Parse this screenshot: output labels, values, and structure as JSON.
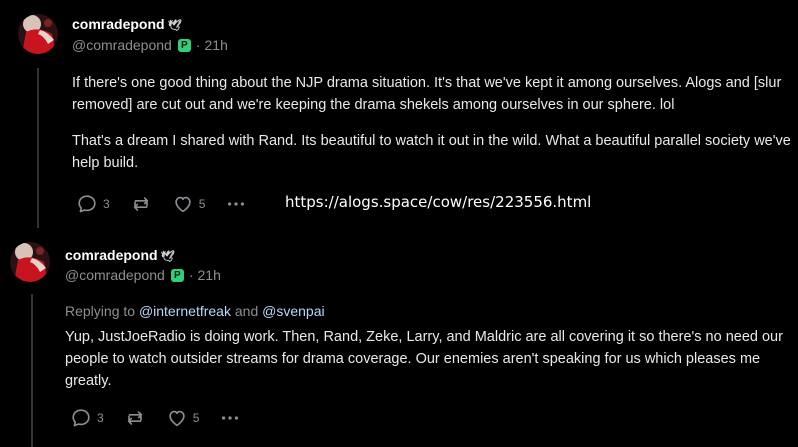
{
  "posts": [
    {
      "display_name": "comradepond",
      "name_emoji": "🕊",
      "handle": "@comradepond",
      "badge_letter": "P",
      "separator": "·",
      "timestamp": "21h",
      "body": [
        "If there's one good thing about the NJP drama situation. It's that we've kept it among ourselves. Alogs and [slur removed] are cut out and we're keeping the drama shekels among ourselves in our sphere. lol",
        "That's a dream I shared with Rand. Its beautiful to watch it out in the wild. What a beautiful parallel society we've help build."
      ],
      "actions": {
        "reply_count": "3",
        "like_count": "5"
      }
    },
    {
      "display_name": "comradepond",
      "name_emoji": "🕊",
      "handle": "@comradepond",
      "badge_letter": "P",
      "separator": "·",
      "timestamp": "21h",
      "replying_prefix": "Replying to ",
      "replying_mention_1": "@internetfreak",
      "replying_and": " and ",
      "replying_mention_2": "@svenpai",
      "body": [
        "Yup, JustJoeRadio is doing work. Then, Rand, Zeke, Larry, and Maldric are all covering it so there's no need our people to watch outsider streams for drama coverage. Our enemies aren't speaking for us which pleases me greatly."
      ],
      "actions": {
        "reply_count": "3",
        "like_count": "5"
      }
    }
  ],
  "overlay_url": "https://alogs.space/cow/res/223556.html",
  "icons": {
    "reply": "speech-bubble-icon",
    "repost": "repost-arrows-icon",
    "like": "heart-icon",
    "more": "ellipsis-icon"
  },
  "colors": {
    "background": "#000000",
    "text": "#e7e9ea",
    "muted": "#8b8f93",
    "mention": "#b6d7f5",
    "badge": "#2fd07a",
    "avatar_red": "#c8141e"
  }
}
